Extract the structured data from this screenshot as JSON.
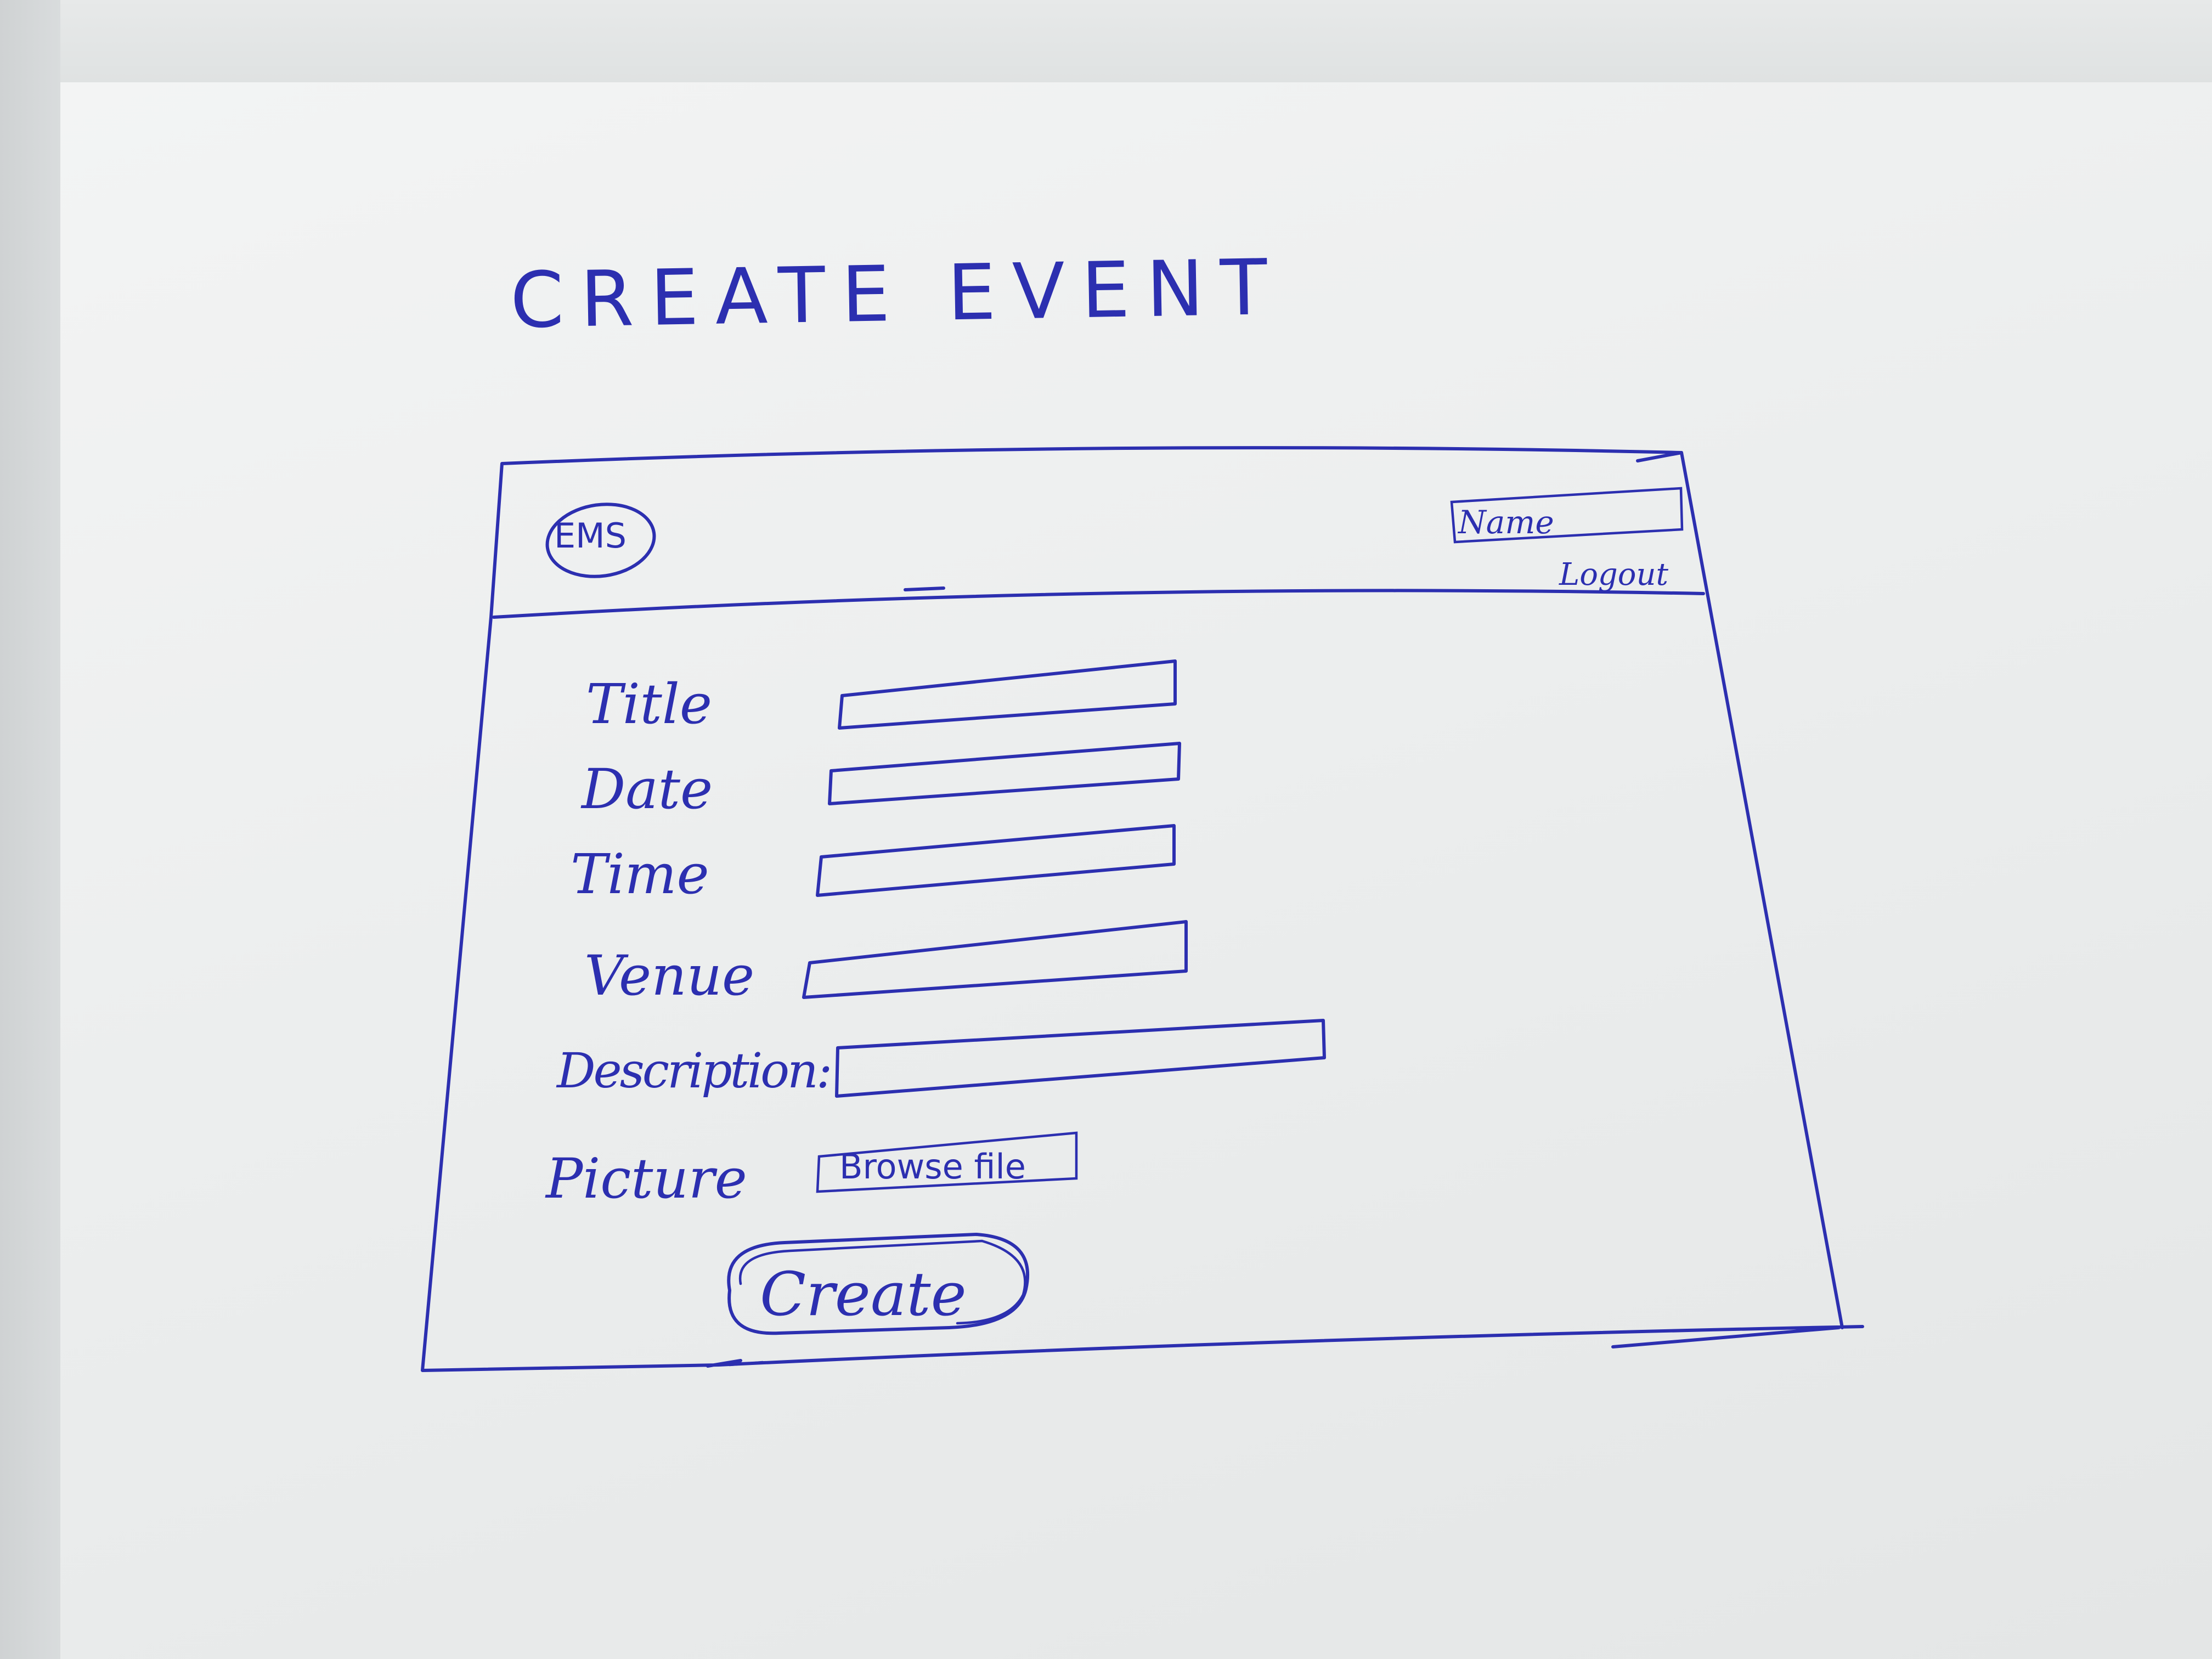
{
  "page": {
    "title": "CREATE EVENT"
  },
  "header": {
    "logo": "EMS",
    "user_name": "Name",
    "logout": "Logout"
  },
  "form": {
    "fields": [
      {
        "label": "Title",
        "value": ""
      },
      {
        "label": "Date",
        "value": ""
      },
      {
        "label": "Time",
        "value": ""
      },
      {
        "label": "Venue",
        "value": ""
      },
      {
        "label": "Description:",
        "value": ""
      }
    ],
    "picture_label": "Picture",
    "browse_button": "Browse file",
    "submit_button": "Create"
  },
  "colors": {
    "ink": "#2c2fb0",
    "paper": "#eef0f0"
  },
  "icons": {
    "logo": "ems-circle-logo"
  }
}
